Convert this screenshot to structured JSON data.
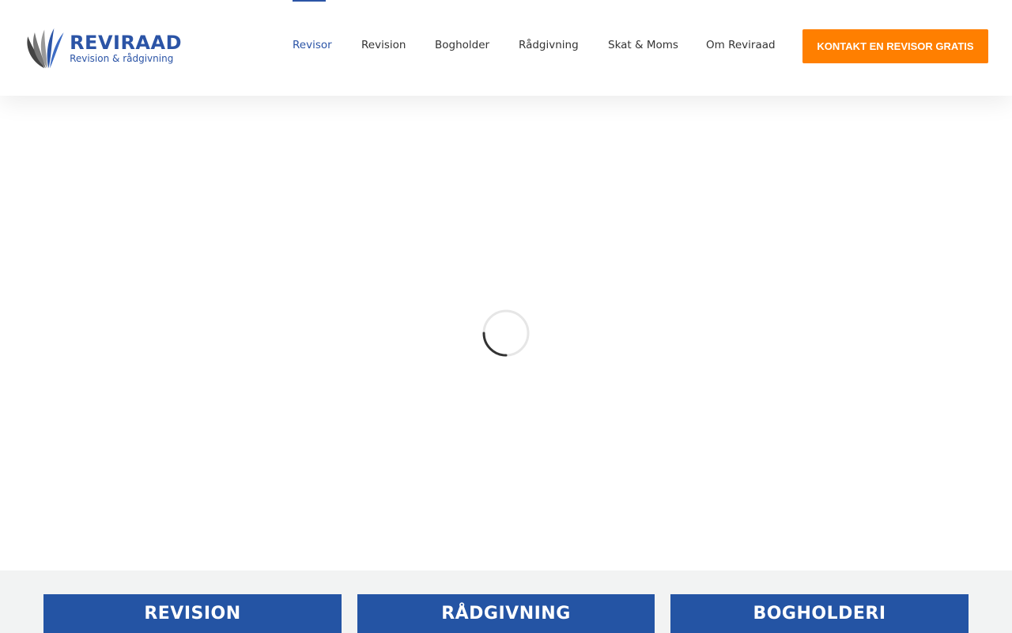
{
  "brand": {
    "name": "REVIRAAD",
    "tagline": "Revision & rådgivning"
  },
  "nav": {
    "items": [
      {
        "label": "Revisor",
        "active": true
      },
      {
        "label": "Revision",
        "active": false
      },
      {
        "label": "Bogholder",
        "active": false
      },
      {
        "label": "Rådgivning",
        "active": false
      },
      {
        "label": "Skat & Moms",
        "active": false
      },
      {
        "label": "Om Reviraad",
        "active": false
      }
    ]
  },
  "cta": {
    "label": "KONTAKT EN REVISOR GRATIS",
    "color": "#ff7f00"
  },
  "loader": {
    "icon": "loading-spinner-icon"
  },
  "services": [
    {
      "label": "REVISION"
    },
    {
      "label": "RÅDGIVNING"
    },
    {
      "label": "BOGHOLDERI"
    }
  ],
  "colors": {
    "brand_blue": "#2b54a6",
    "card_blue": "#2454a4",
    "accent_orange": "#ff7f00",
    "section_bg": "#f2f3f3"
  }
}
